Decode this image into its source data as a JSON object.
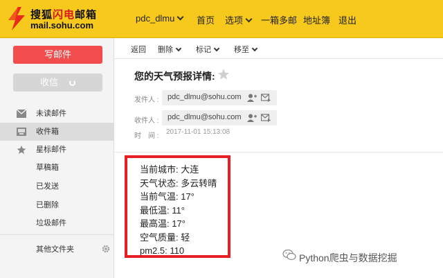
{
  "header": {
    "logo_cn_prefix": "搜狐",
    "logo_cn_red": "闪电",
    "logo_cn_suffix": "邮箱",
    "logo_en": "mail.sohu.com",
    "user": "pdc_dlmu",
    "nav": [
      "首页",
      "选项",
      "一箱多邮",
      "地址簿",
      "退出"
    ]
  },
  "sidebar": {
    "compose_label": "写邮件",
    "receive_label": "收信",
    "folders": [
      {
        "label": "未读邮件",
        "icon": "envelope-icon"
      },
      {
        "label": "收件箱",
        "icon": "inbox-icon",
        "active": true
      },
      {
        "label": "星标邮件",
        "icon": "star-icon"
      },
      {
        "label": "草稿箱"
      },
      {
        "label": "已发送"
      },
      {
        "label": "已删除"
      },
      {
        "label": "垃圾邮件"
      }
    ],
    "other_folders": "其他文件夹"
  },
  "toolbar": {
    "back": "返回",
    "delete": "删除",
    "mark": "标记",
    "move": "移至"
  },
  "mail": {
    "subject": "您的天气预报详情:",
    "from_label": "发件人 :",
    "from_value": "pdc_dlmu@sohu.com",
    "to_label": "收件人 :",
    "to_value": "pdc_dlmu@sohu.com",
    "time_label": "时　间 :",
    "time_value": "2017-11-01 15:13:08",
    "body_lines": [
      "当前城市: 大连",
      "天气状态: 多云转晴",
      "当前气温: 17°",
      "最低温: 11°",
      "最高温: 17°",
      "空气质量: 轻",
      "pm2.5: 110"
    ]
  },
  "watermark": "Python爬虫与数据挖掘",
  "colors": {
    "header_bg": "#f7c91c",
    "compose_btn": "#f24c4c",
    "highlight_border": "#e81e25"
  }
}
